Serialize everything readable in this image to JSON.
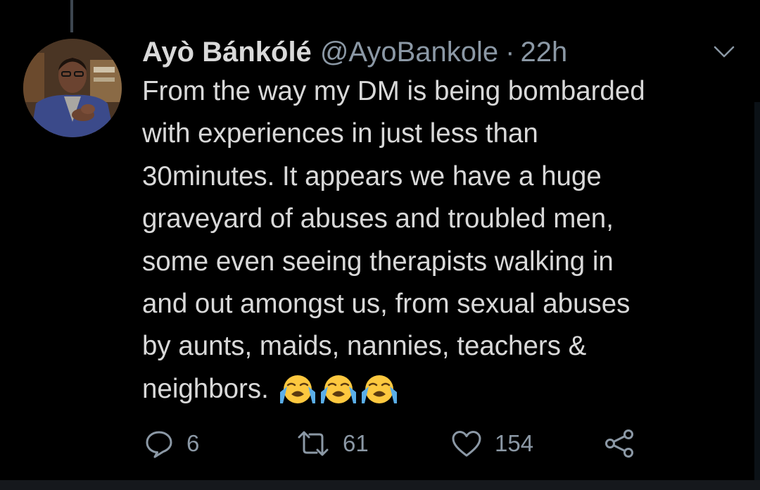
{
  "tweet": {
    "display_name": "Ayò Bánkólé",
    "handle": "@AyoBankole",
    "separator": "·",
    "time": "22h",
    "text": "From the way my DM is being bombarded\nwith experiences in just less than\n30minutes. It appears we have a huge\ngraveyard of abuses and troubled men,\nsome even seeing therapists walking in\nand out amongst us, from sexual abuses\nby aunts, maids, nannies, teachers &\nneighbors.",
    "emojis": [
      "loudly-crying-face",
      "loudly-crying-face",
      "loudly-crying-face"
    ]
  },
  "actions": {
    "reply_count": "6",
    "retweet_count": "61",
    "like_count": "154"
  },
  "icons": {
    "menu": "chevron-down-icon",
    "reply": "reply-icon",
    "retweet": "retweet-icon",
    "like": "heart-icon",
    "share": "share-icon"
  },
  "colors": {
    "background": "#000000",
    "primary_text": "#d9d9d9",
    "secondary_text": "#8b98a5",
    "emoji_face": "#fdc83f",
    "emoji_tears": "#5aaee8"
  }
}
